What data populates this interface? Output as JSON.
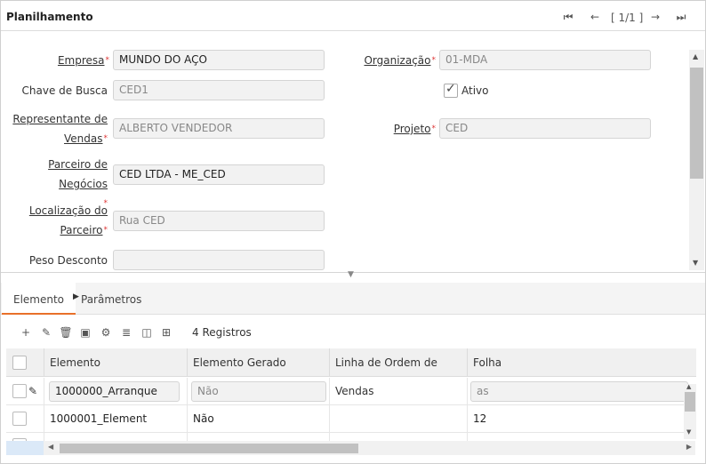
{
  "window": {
    "title": "Planilhamento"
  },
  "pager": {
    "text": "[ 1/1 ]"
  },
  "icons": {
    "first": "⏮",
    "prev": "←",
    "next": "→",
    "last": "⏭",
    "check": "✓",
    "up": "▲",
    "down": "▼",
    "left": "◀",
    "right": "▶",
    "edit": "✎"
  },
  "form": {
    "empresa": {
      "label": "Empresa",
      "value": "MUNDO DO AÇO"
    },
    "organizacao": {
      "label": "Organização",
      "value": "01-MDA"
    },
    "chave_busca": {
      "label": "Chave de Busca",
      "value": "CED1"
    },
    "ativo": {
      "label": "Ativo",
      "checked": true
    },
    "representante": {
      "label_line1": "Representante de",
      "label_line2": "Vendas",
      "value": "ALBERTO VENDEDOR"
    },
    "projeto": {
      "label": "Projeto",
      "value": "CED"
    },
    "parceiro": {
      "label_line1": "Parceiro de Negócios",
      "value": "CED LTDA - ME_CED"
    },
    "localizacao": {
      "label_line1": "Localização do",
      "label_line2": "Parceiro",
      "value": "Rua CED"
    },
    "peso_desconto": {
      "label": "Peso Desconto",
      "value": ""
    }
  },
  "tabs": [
    {
      "label": "Elemento"
    },
    {
      "label": "Parâmetros"
    }
  ],
  "toolbar": {
    "icons": [
      "plus-icon",
      "edit-icon",
      "trash-icon",
      "save-icon",
      "gear-icon",
      "list-icon",
      "columns-icon",
      "grid-icon"
    ],
    "records": "4 Registros"
  },
  "grid": {
    "columns": [
      "Elemento",
      "Elemento Gerado",
      "Linha de Ordem de Vendas",
      "Folha"
    ],
    "rows": [
      {
        "elemento": "1000000_Arranque",
        "gerado": "Não",
        "linha": "",
        "folha": "as"
      },
      {
        "elemento": "1000001_Element",
        "gerado": "Não",
        "linha": "",
        "folha": "12"
      }
    ]
  }
}
